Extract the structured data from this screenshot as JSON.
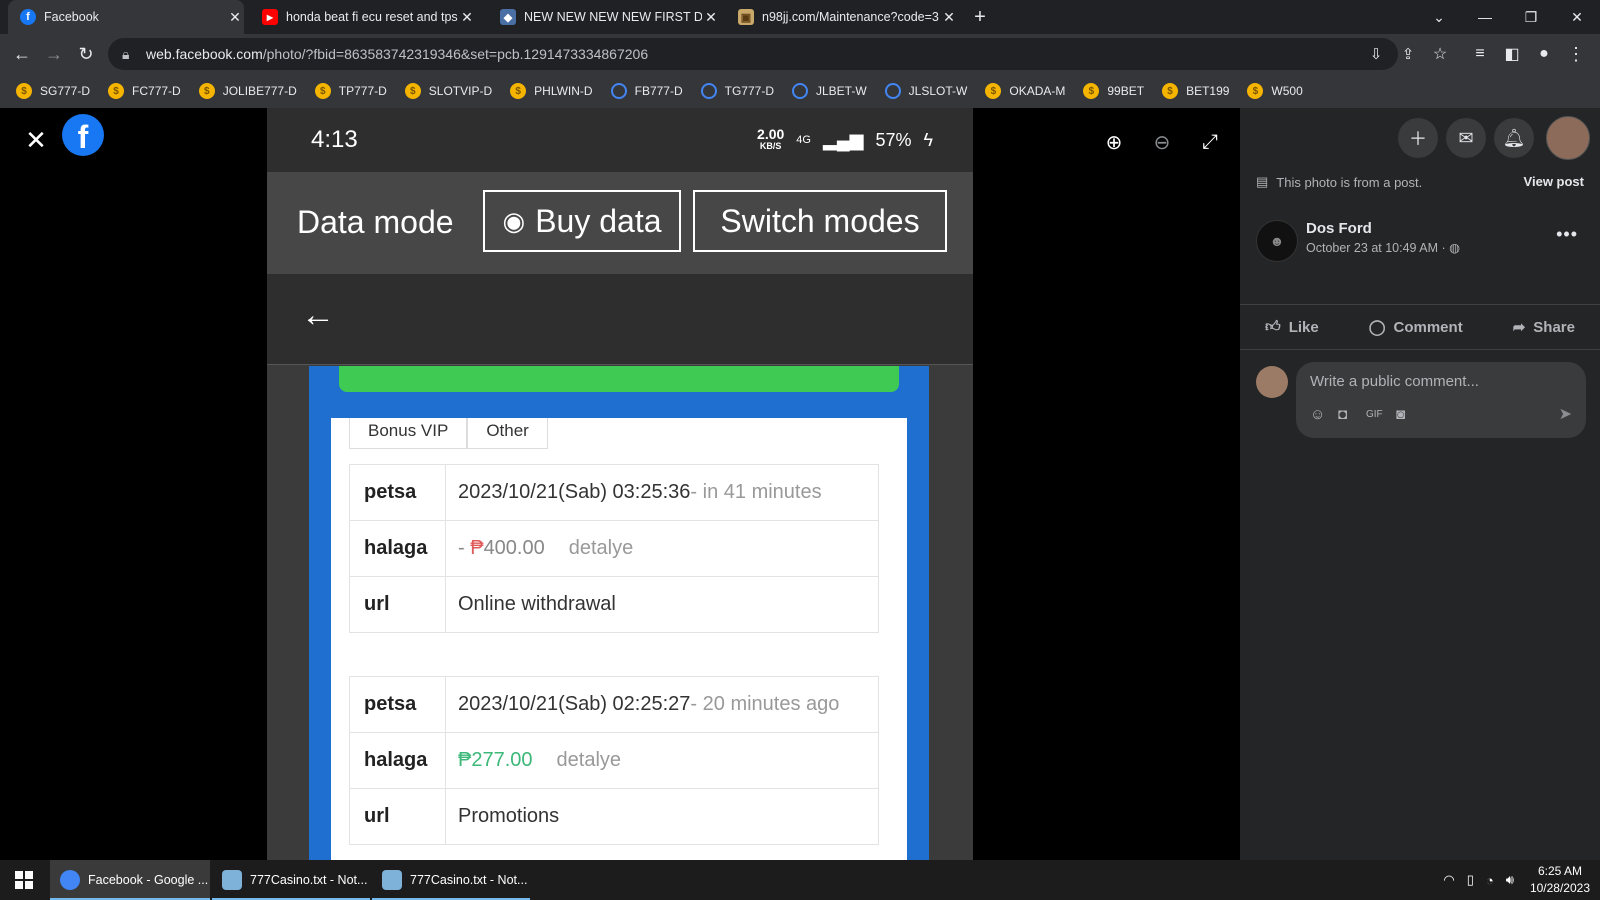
{
  "browser": {
    "tabs": [
      {
        "title": "Facebook",
        "favicon": "facebook-f",
        "active": true
      },
      {
        "title": "honda beat fi ecu reset and tps",
        "favicon": "youtube-play"
      },
      {
        "title": "NEW NEW NEW NEW FIRST DEP",
        "favicon": "shield-logo"
      },
      {
        "title": "n98jj.com/Maintenance?code=3",
        "favicon": "site-logo"
      }
    ],
    "new_tab": "+",
    "url_host": "web.facebook.com",
    "url_path": "/photo/?fbid=863583742319346&set=pcb.1291473334867206",
    "bookmarks": [
      {
        "label": "SG777-D",
        "icon": "coin"
      },
      {
        "label": "FC777-D",
        "icon": "coin"
      },
      {
        "label": "JOLIBE777-D",
        "icon": "coin"
      },
      {
        "label": "TP777-D",
        "icon": "coin"
      },
      {
        "label": "SLOTVIP-D",
        "icon": "coin"
      },
      {
        "label": "PHLWIN-D",
        "icon": "coin"
      },
      {
        "label": "FB777-D",
        "icon": "ring"
      },
      {
        "label": "TG777-D",
        "icon": "ring"
      },
      {
        "label": "JLBET-W",
        "icon": "ring"
      },
      {
        "label": "JLSLOT-W",
        "icon": "ring"
      },
      {
        "label": "OKADA-M",
        "icon": "coin"
      },
      {
        "label": "99BET",
        "icon": "coin"
      },
      {
        "label": "BET199",
        "icon": "coin"
      },
      {
        "label": "W500",
        "icon": "coin"
      }
    ]
  },
  "photo": {
    "phone_time": "4:13",
    "speed_value": "2.00",
    "speed_unit": "KB/S",
    "network": "4G",
    "battery": "57%",
    "data_mode_label": "Data mode",
    "buy_data_label": "Buy data",
    "switch_modes_label": "Switch modes",
    "tabs": [
      "Bonus VIP",
      "Other"
    ],
    "transactions": [
      {
        "date_key": "petsa",
        "date": "2023/10/21(Sab) 03:25:36",
        "relative": "- in 41 minutes",
        "amount_key": "halaga",
        "amount_prefix": "- ",
        "currency": "₱",
        "amount": "400.00",
        "detail": "detalye",
        "url_key": "url",
        "url": "Online withdrawal"
      },
      {
        "date_key": "petsa",
        "date": "2023/10/21(Sab) 02:25:27",
        "relative": "- 20 minutes ago",
        "amount_key": "halaga",
        "amount_prefix": "",
        "currency": "₱",
        "amount": "277.00",
        "detail": "detalye",
        "url_key": "url",
        "url": "Promotions"
      }
    ]
  },
  "panel": {
    "post_note": "This photo is from a post.",
    "view_post": "View post",
    "author": "Dos Ford",
    "time": "October 23 at 10:49 AM · ",
    "more": "•••",
    "like": "Like",
    "comment": "Comment",
    "share": "Share",
    "comment_placeholder": "Write a public comment..."
  },
  "taskbar": {
    "items": [
      {
        "label": "Facebook - Google ...",
        "active": true
      },
      {
        "label": "777Casino.txt - Not..."
      },
      {
        "label": "777Casino.txt - Not..."
      }
    ],
    "time": "6:25 AM",
    "date": "10/28/2023"
  },
  "colors": {
    "facebook_blue": "#1877f2",
    "withdrawal_red": "#e05a5a",
    "deposit_green": "#3cb878",
    "site_blue": "#1e6fd0",
    "site_green": "#3fca54"
  }
}
